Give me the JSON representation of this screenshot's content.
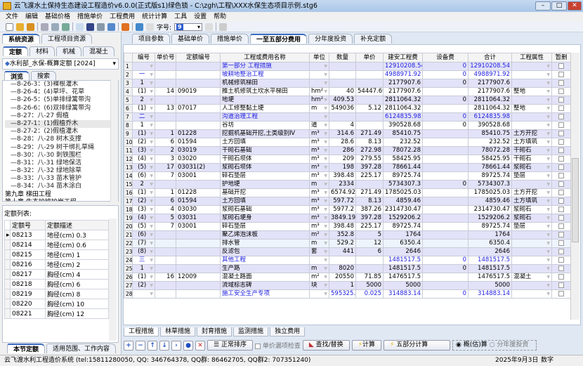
{
  "window": {
    "title": "云飞渡水土保持生态建设工程造价v6.0.0(正式版s1)绿色锁 - C:\\zgh\\工程\\XXX水保生态项目示例.stg6"
  },
  "menu": [
    "文件",
    "编辑",
    "基础价格",
    "措施单价",
    "工程费用",
    "统计计算",
    "工具",
    "设置",
    "帮助"
  ],
  "toolbar": {
    "font_label": "字号:",
    "font_value": "9"
  },
  "left": {
    "tabs": [
      "系统资源",
      "工程项目资源"
    ],
    "subtabs": [
      "定额",
      "材料",
      "机械",
      "混凝土"
    ],
    "dinge_select": "水利部_水保-概算定额 [2024]",
    "browse_tabs": [
      "浏览",
      "搜索"
    ],
    "tree": [
      "8-26-3：(3)裸根灌木",
      "8-26-4：(4)草坪、花草",
      "8-26-5：(5)单排绿篱带沟",
      "8-26-6：(6)双排绿篱带沟",
      "8-27：八-27 假植",
      "8-27-1：(1)假植乔木",
      "8-27-2：(2)假植灌木",
      "8-28：八-28 树木支撑",
      "8-29：八-29 树干绑扎草绳",
      "8-30：八-30 刺铁围栏",
      "8-31：八-31 绿地保洁",
      "8-32：八-32 绿地除草",
      "8-33：八-33 苗木管护",
      "8-34：八-34 苗木涂白"
    ],
    "chapters": [
      "第九章 梯田工程",
      "第十章 生态护坡护岸工程",
      "第十一章 谷坊、水窖、蓄水池工程",
      "第十二章 其他工程"
    ],
    "list_title": "定额列表:",
    "list_headers": [
      "定额号",
      "定额描述"
    ],
    "list_rows": [
      [
        "08213",
        "地径(cm) 0.3"
      ],
      [
        "08214",
        "地径(cm) 0.6"
      ],
      [
        "08215",
        "地径(cm) 1"
      ],
      [
        "08216",
        "地径(cm) 2"
      ],
      [
        "08217",
        "胸径(cm) 4"
      ],
      [
        "08218",
        "胸径(cm) 6"
      ],
      [
        "08219",
        "胸径(cm) 8"
      ],
      [
        "08220",
        "胸径(cm) 10"
      ],
      [
        "08221",
        "胸径(cm) 12"
      ]
    ],
    "bottom_tabs": [
      "本节定额",
      "适用范围、工作内容"
    ]
  },
  "main": {
    "tabs": [
      "项目参数",
      "基础单价",
      "措施单价",
      "一至五部分费用",
      "分年度投资",
      "补充定额"
    ],
    "active_tab": "一至五部分费用",
    "headers": [
      "",
      "编号",
      "单价号",
      "定额编号",
      "工程或费用名称",
      "单位",
      "数量",
      "单价",
      "建安工程费",
      "设备费",
      "合计",
      "工程属性",
      "暂删"
    ],
    "rows": [
      [
        "1",
        "",
        "",
        "",
        "第一部分 工程措施",
        "",
        "",
        "",
        "12910208.54",
        "0",
        "12910208.54",
        "",
        true
      ],
      [
        "2",
        "一",
        "",
        "",
        "坡耕地整治工程",
        "",
        "",
        "",
        "4988971.92",
        "0",
        "4988971.92",
        "",
        true
      ],
      [
        "3",
        "1",
        "",
        "",
        "机械修筑梯田",
        "",
        "",
        "",
        "2177907.6",
        "0",
        "2177907.6",
        "",
        false
      ],
      [
        "4",
        "(1)",
        "14",
        "09019",
        "推土机修筑土坎水平梯田",
        "hm²",
        "40",
        "54447.69",
        "2177907.6",
        "",
        "2177907.6",
        "整地",
        false
      ],
      [
        "5",
        "2",
        "",
        "",
        "  地埂",
        "hm²",
        "409.53",
        "",
        "2811064.32",
        "0",
        "2811064.32",
        "",
        false
      ],
      [
        "6",
        "(1)",
        "13",
        "07017",
        "人工修整黏土埂",
        "m",
        "549036",
        "5.12",
        "2811064.32",
        "",
        "2811064.32",
        "整地",
        false
      ],
      [
        "7",
        "二",
        "",
        "",
        "沟道治理工程",
        "",
        "",
        "",
        "6124835.98",
        "0",
        "6124835.98",
        "",
        true
      ],
      [
        "8",
        "1",
        "",
        "",
        "谷坊",
        "道",
        "4",
        "",
        "390528.68",
        "0",
        "390528.68",
        "",
        false
      ],
      [
        "9",
        "(1)",
        "1",
        "01228",
        "挖掘机基础开挖,土类级别Ⅳ",
        "m³",
        "314.6",
        "271.49",
        "85410.75",
        "",
        "85410.75",
        "土方开挖",
        false
      ],
      [
        "10",
        "(2)",
        "6",
        "01594",
        "土方回填",
        "m³",
        "28.6",
        "8.13",
        "232.52",
        "",
        "232.52",
        "土方填筑",
        false
      ],
      [
        "11",
        "(3)",
        "2",
        "03019",
        "干砌石基础",
        "m³",
        "286",
        "272.98",
        "78072.28",
        "",
        "78072.28",
        "干砌石",
        false
      ],
      [
        "12",
        "(4)",
        "3",
        "03020",
        "干砌石坝体",
        "m³",
        "209",
        "279.55",
        "58425.95",
        "",
        "58425.95",
        "干砌石",
        false
      ],
      [
        "13",
        "(5)",
        "17",
        "03031(2)",
        "浆砌石坝体",
        "m³",
        "198",
        "397.28",
        "78661.44",
        "",
        "78661.44",
        "浆砌石",
        false
      ],
      [
        "14",
        "(6)",
        "7",
        "03001",
        "碎石垫层",
        "m³",
        "398.48",
        "225.17",
        "89725.74",
        "",
        "89725.74",
        "垫层",
        false
      ],
      [
        "15",
        "2",
        "",
        "",
        "护地埂",
        "m",
        "2334",
        "",
        "5734307.3",
        "0",
        "5734307.3",
        "",
        false
      ],
      [
        "16",
        "(1)",
        "1",
        "01228",
        "基础开挖",
        "m³",
        "6574.92",
        "271.49",
        "1785025.03",
        "",
        "1785025.03",
        "土方开挖",
        false
      ],
      [
        "17",
        "(2)",
        "6",
        "01594",
        "土方回填",
        "m³",
        "597.72",
        "8.13",
        "4859.46",
        "",
        "4859.46",
        "土方填筑",
        false
      ],
      [
        "18",
        "(3)",
        "4",
        "03030",
        "浆砌石基础",
        "m³",
        "5977.2",
        "387.26",
        "2314730.47",
        "",
        "2314730.47",
        "浆砌石",
        false
      ],
      [
        "19",
        "(4)",
        "5",
        "03031",
        "浆砌石埂身",
        "m³",
        "3849.19",
        "397.28",
        "1529206.2",
        "",
        "1529206.2",
        "浆砌石",
        false
      ],
      [
        "20",
        "(5)",
        "7",
        "03001",
        "碎石垫层",
        "m³",
        "398.48",
        "225.17",
        "89725.74",
        "",
        "89725.74",
        "垫层",
        false
      ],
      [
        "21",
        "(6)",
        "",
        "",
        "聚乙烯泡沫板",
        "m²",
        "352.8",
        "5",
        "1764",
        "",
        "1764",
        "",
        false
      ],
      [
        "22",
        "(7)",
        "",
        "",
        "排水管",
        "m",
        "529.2",
        "12",
        "6350.4",
        "",
        "6350.4",
        "",
        false
      ],
      [
        "23",
        "(8)",
        "",
        "",
        "反滤包",
        "套",
        "441",
        "6",
        "2646",
        "",
        "2646",
        "",
        false
      ],
      [
        "24",
        "三",
        "",
        "",
        "其他工程",
        "",
        "",
        "",
        "1481517.5",
        "0",
        "1481517.5",
        "",
        true
      ],
      [
        "25",
        "1",
        "",
        "",
        "生产路",
        "m",
        "8020",
        "",
        "1481517.5",
        "0",
        "1481517.5",
        "",
        false
      ],
      [
        "26",
        "(1)",
        "16",
        "12009",
        "混凝土路面",
        "m²",
        "20550",
        "71.85",
        "1476517.5",
        "",
        "1476517.5",
        "混凝土",
        false
      ],
      [
        "27",
        "(2)",
        "",
        "",
        "流域标志碑",
        "块",
        "1",
        "5000",
        "5000",
        "",
        "5000",
        "",
        false
      ],
      [
        "28",
        "",
        "",
        "",
        "施工安全生产专项",
        "",
        "595325.4",
        "0.025",
        "314883.14",
        "0",
        "314883.14",
        "",
        true
      ]
    ],
    "selected_row": "22",
    "bottom_tabs": [
      "工程措施",
      "林草措施",
      "封育措施",
      "监测措施",
      "独立费用"
    ],
    "buttons": {
      "sort": "正常排序",
      "check": "单价漏项检查",
      "find": "查找/替换",
      "calc": "计算",
      "five": "五部分计算",
      "radio1": "概(估)算",
      "radio2": "分年度投资"
    }
  },
  "status": {
    "text": "云飞渡水利工程造价系统    (tel:15811280050, QQ: 346764378, QQ群: 86462705, QQ群2: 707351240)",
    "date": "2025年9月3日",
    "mode": "数字"
  },
  "colors": {
    "row_alt": "#e2e2f8",
    "blue_text": "#2020e0",
    "accent": "#3a6cc0"
  }
}
